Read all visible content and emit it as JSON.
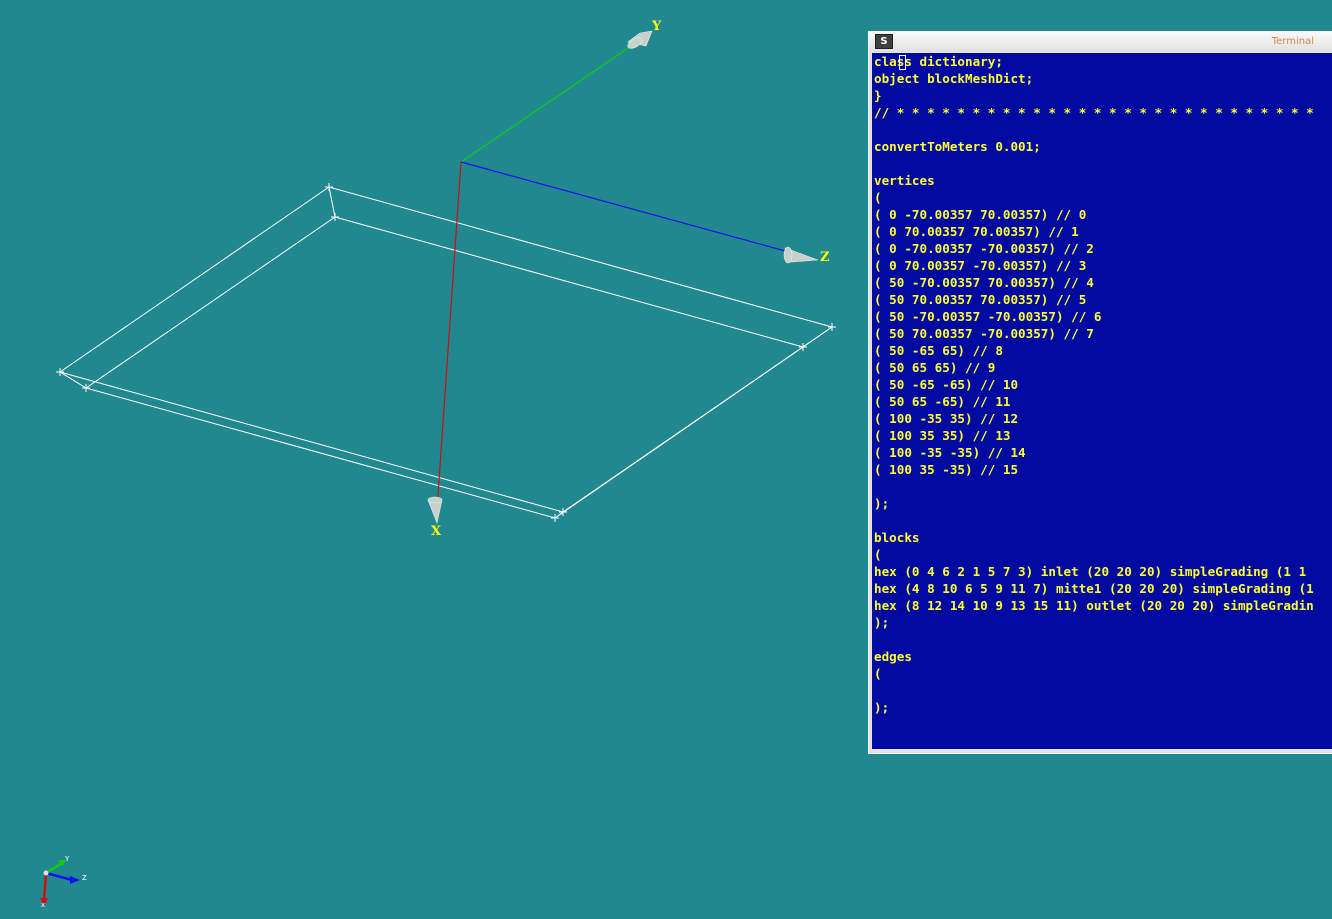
{
  "viewport": {
    "axis_labels": {
      "x": "X",
      "y": "Y",
      "z": "Z"
    },
    "triad_labels": {
      "x": "x",
      "y": "Y",
      "z": "Z"
    },
    "colors": {
      "background": "#228890",
      "x_axis": "#cc1010",
      "y_axis": "#10cc10",
      "z_axis": "#1010ee",
      "wireframe": "#ffffff",
      "axis_label": "#ffff00"
    }
  },
  "terminal": {
    "title": "Terminal",
    "menu_icon": "terminal-menu-icon",
    "lines": [
      "class dictionary;",
      "object blockMeshDict;",
      "}",
      "// * * * * * * * * * * * * * * * * * * * * * * * * * * * *",
      "",
      "convertToMeters 0.001;",
      "",
      "vertices",
      "(",
      "( 0 -70.00357 70.00357) // 0",
      "( 0 70.00357 70.00357) // 1",
      "( 0 -70.00357 -70.00357) // 2",
      "( 0 70.00357 -70.00357) // 3",
      "( 50 -70.00357 70.00357) // 4",
      "( 50 70.00357 70.00357) // 5",
      "( 50 -70.00357 -70.00357) // 6",
      "( 50 70.00357 -70.00357) // 7",
      "( 50 -65 65) // 8",
      "( 50 65 65) // 9",
      "( 50 -65 -65) // 10",
      "( 50 65 -65) // 11",
      "( 100 -35 35) // 12",
      "( 100 35 35) // 13",
      "( 100 -35 -35) // 14",
      "( 100 35 -35) // 15",
      "",
      ");",
      "",
      "blocks",
      "(",
      "hex (0 4 6 2 1 5 7 3) inlet (20 20 20) simpleGrading (1 1",
      "hex (4 8 10 6 5 9 11 7) mitte1 (20 20 20) simpleGrading (1",
      "hex (8 12 14 10 9 13 15 11) outlet (20 20 20) simpleGradin",
      ");",
      "",
      "edges",
      "(",
      "",
      ");"
    ],
    "colors": {
      "background": "#000aa0",
      "text": "#ffff33"
    }
  }
}
